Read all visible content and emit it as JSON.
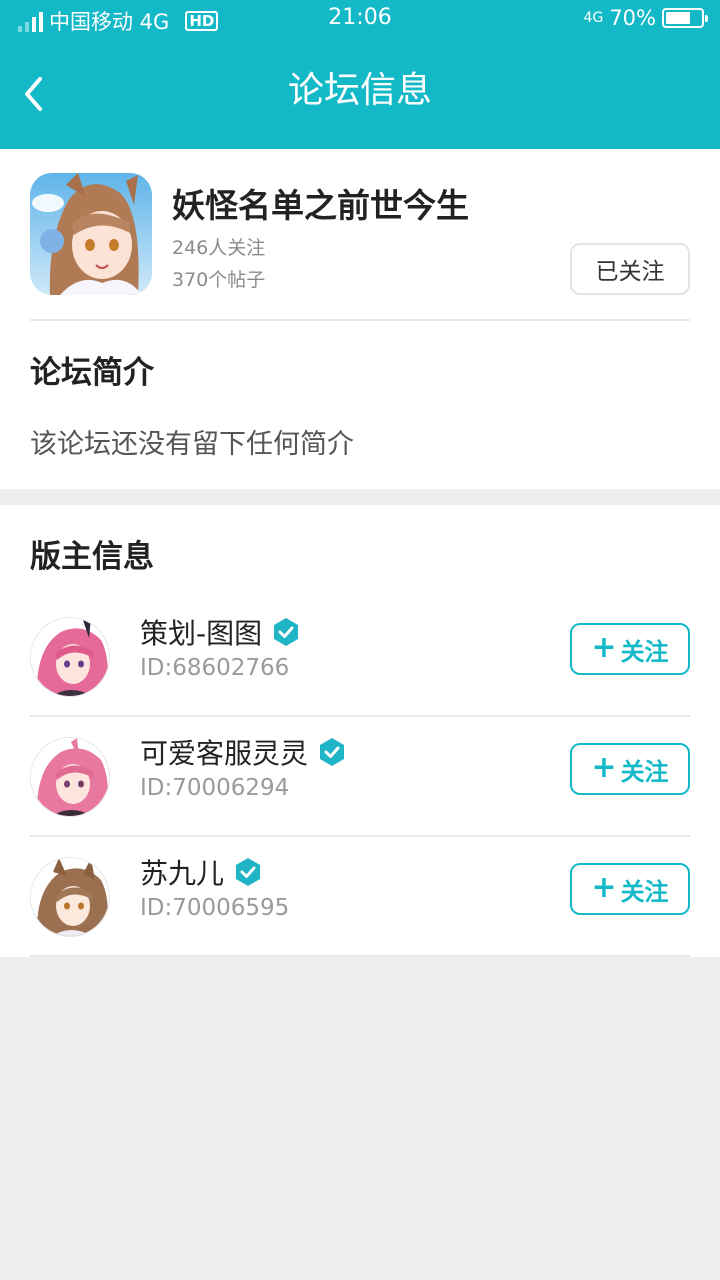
{
  "status_bar": {
    "carrier": "中国移动 4G",
    "hd": "HD",
    "time": "21:06",
    "net": "4G",
    "battery_pct": "70%",
    "battery_level": 0.7
  },
  "header": {
    "title": "论坛信息",
    "back_icon": "chevron-left-icon"
  },
  "forum": {
    "name": "妖怪名单之前世今生",
    "followers": "246人关注",
    "posts": "370个帖子",
    "follow_state_label": "已关注"
  },
  "intro": {
    "title": "论坛简介",
    "text": "该论坛还没有留下任何简介"
  },
  "moderators": {
    "title": "版主信息",
    "follow_label": "关注",
    "items": [
      {
        "name": "策划-图图",
        "id": "ID:68602766",
        "hair": "#e56a9a"
      },
      {
        "name": "可爱客服灵灵",
        "id": "ID:70006294",
        "hair": "#e8789f"
      },
      {
        "name": "苏九儿",
        "id": "ID:70006595",
        "hair": "#9a7050"
      }
    ]
  },
  "colors": {
    "accent": "#14b9c8",
    "background": "#ededed",
    "verified": "#1fb4c6"
  }
}
